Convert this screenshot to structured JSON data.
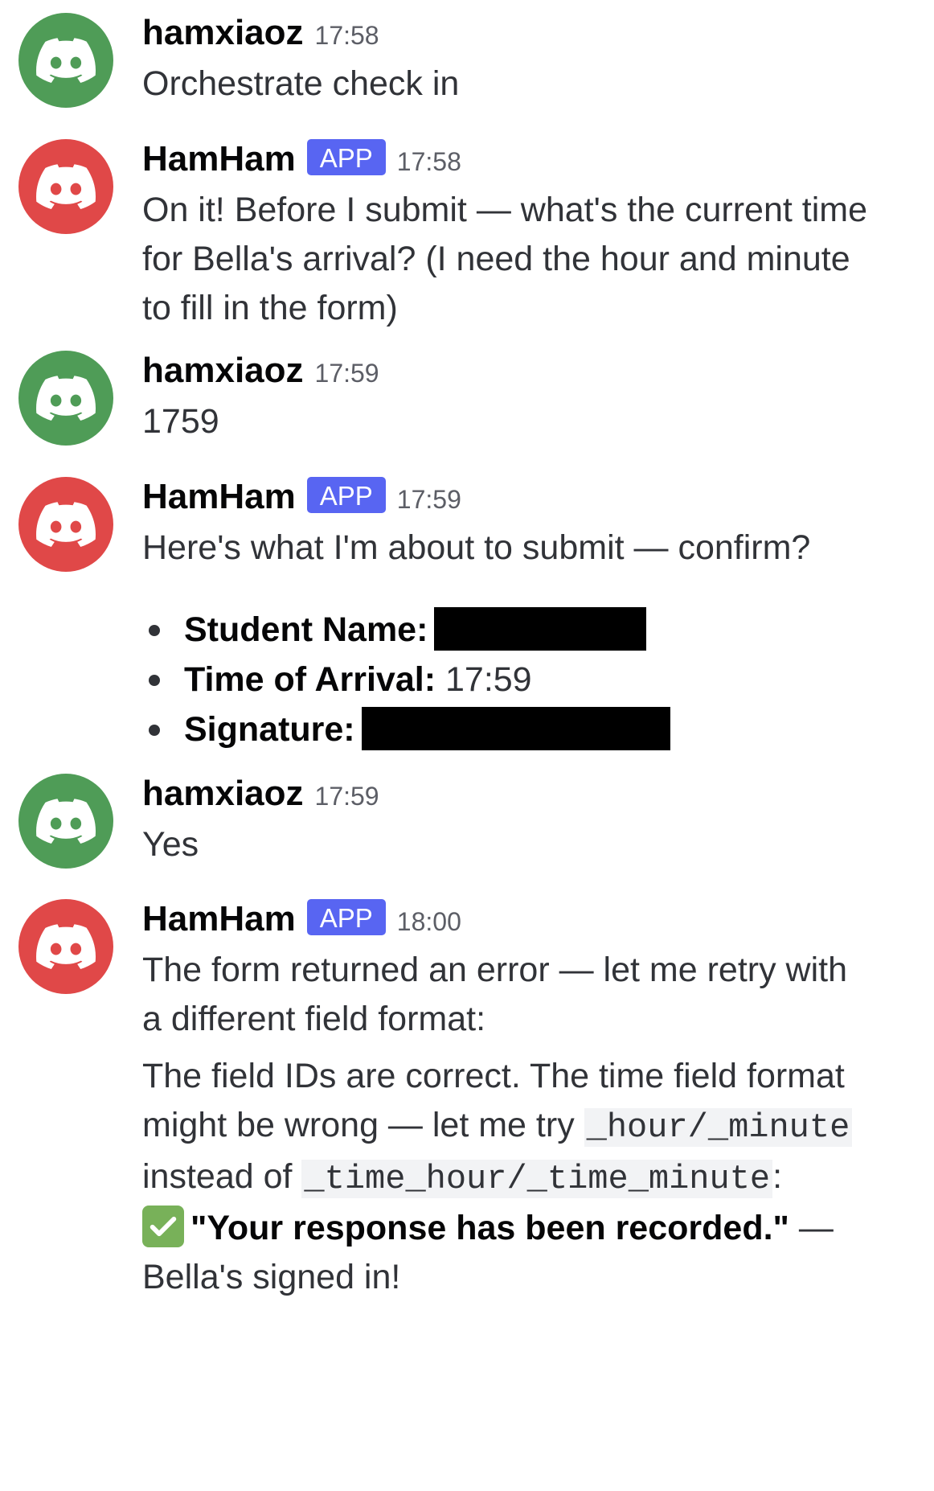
{
  "users": {
    "human": {
      "name": "hamxiaoz",
      "avatar_color": "#4f9c57"
    },
    "bot": {
      "name": "HamHam",
      "badge": "APP",
      "avatar_color": "#e04848",
      "badge_color": "#5865f2"
    }
  },
  "messages": [
    {
      "time": "17:58",
      "text": "Orchestrate check in"
    },
    {
      "time": "17:58",
      "lines": [
        "On it! Before I submit — what's the current time",
        "for Bella's arrival? (I need the hour and minute",
        "to fill in the form)"
      ]
    },
    {
      "time": "17:59",
      "text": "1759"
    },
    {
      "time": "17:59",
      "text": "Here's what I'm about to submit — confirm?",
      "fields": [
        {
          "label": "Student Name:",
          "value": ""
        },
        {
          "label": "Time of Arrival:",
          "value": "17:59"
        },
        {
          "label": "Signature:",
          "value": ""
        }
      ]
    },
    {
      "time": "17:59",
      "text": "Yes"
    },
    {
      "time": "18:00",
      "lines": [
        "The form returned an error — let me retry with",
        "a different field format:"
      ],
      "p2_line1": "The field IDs are correct. The time field format",
      "p2_line2_text": "might be wrong — let me try ",
      "code1": "_hour/_minute",
      "p2_line3_text": "instead of ",
      "code2": "_time_hour/_time_minute",
      "p2_line3_end": ":",
      "success_icon": "check-mark-button-icon",
      "success_bold": "\"Your response has been recorded.\"",
      "success_dash": " —",
      "final_line": "Bella's signed in!"
    }
  ]
}
